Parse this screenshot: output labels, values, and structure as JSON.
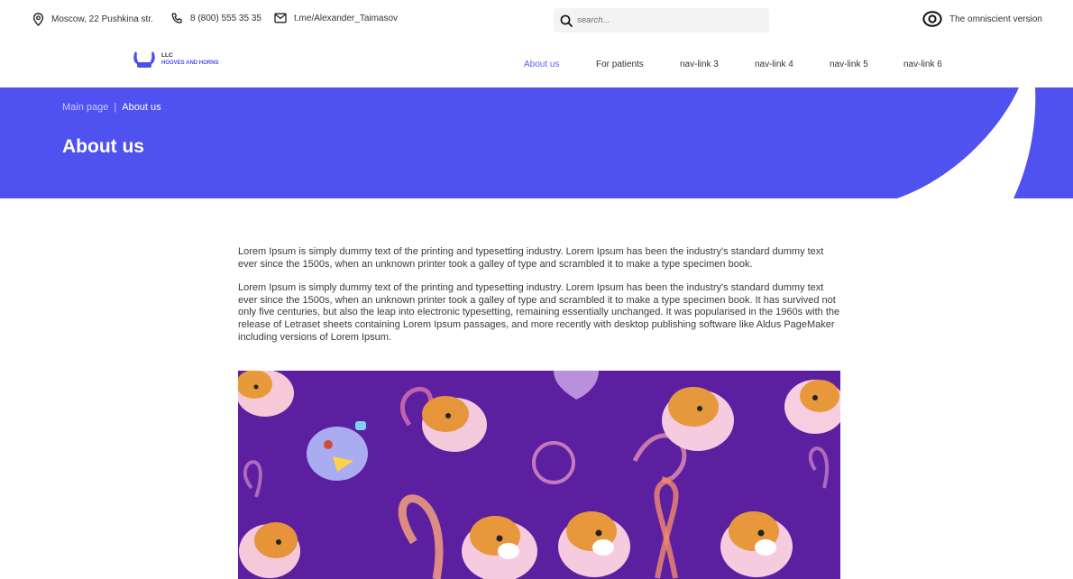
{
  "topbar": {
    "address": "Moscow, 22 Pushkina str.",
    "phone": "8 (800) 555 35 35",
    "telegram": "t.me/Alexander_Taimasov",
    "search_placeholder": "search...",
    "visually_impaired": "The omniscient version"
  },
  "logo": {
    "line1": "LLC",
    "line2": "HOOVES AND HORNS"
  },
  "nav": {
    "items": [
      {
        "label": "About us"
      },
      {
        "label": "For patients"
      },
      {
        "label": "nav-link 3"
      },
      {
        "label": "nav-link 4"
      },
      {
        "label": "nav-link 5"
      },
      {
        "label": "nav-link 6"
      }
    ]
  },
  "breadcrumb": {
    "home": "Main page",
    "separator": "|",
    "current": "About us"
  },
  "page_title": "About us",
  "content": {
    "paragraph1": "Lorem Ipsum is simply dummy text of the printing and typesetting industry. Lorem Ipsum has been the industry's standard dummy text ever since the 1500s, when an unknown printer took a galley of type and scrambled it to make a type specimen book.",
    "paragraph2": "Lorem Ipsum is simply dummy text of the printing and typesetting industry. Lorem Ipsum has been the industry's standard dummy text ever since the 1500s, when an unknown printer took a galley of type and scrambled it to make a type specimen book. It has survived not only five centuries, but also the leap into electronic typesetting, remaining essentially unchanged. It was popularised in the 1960s with the release of Letraset sheets containing Lorem Ipsum passages, and more recently with desktop publishing software like Aldus PageMaker including versions of Lorem Ipsum."
  },
  "icons": {
    "address": "location-pin-icon",
    "phone": "phone-icon",
    "telegram": "mail-icon",
    "search": "search-icon",
    "visually_impaired": "eye-icon",
    "logo": "horns-icon"
  },
  "colors": {
    "accent": "#4f52ee",
    "hero_bg": "#4f52ee",
    "illustration_bg": "#5b1fa0"
  }
}
